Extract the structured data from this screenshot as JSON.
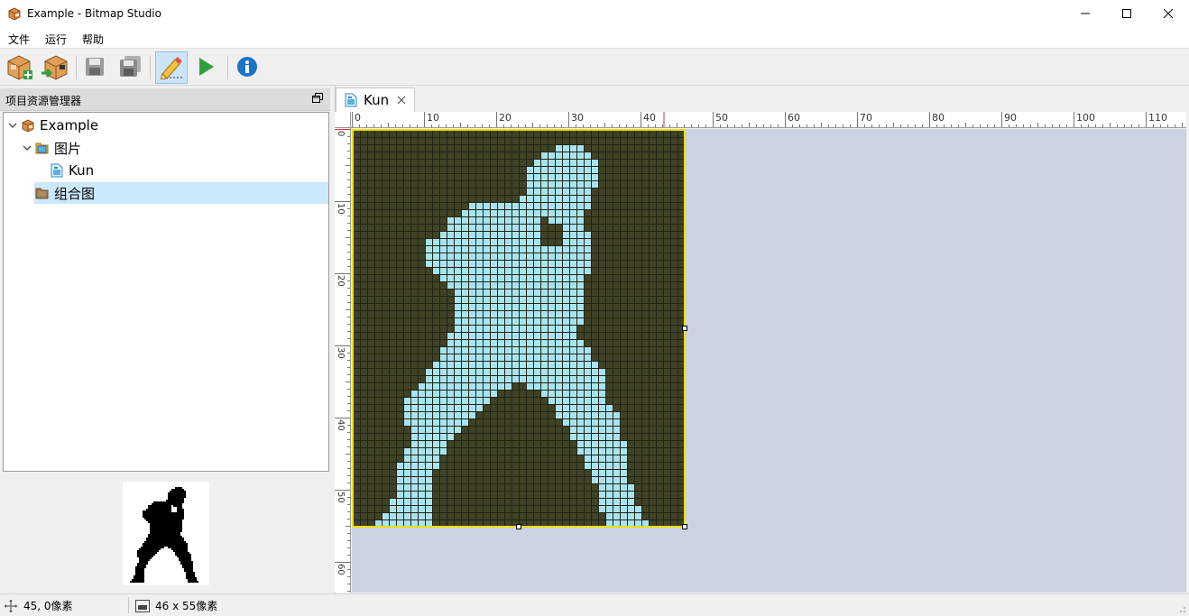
{
  "window": {
    "title": "Example - Bitmap Studio",
    "app_icon": "package-icon"
  },
  "menu": {
    "items": [
      "文件",
      "运行",
      "帮助"
    ]
  },
  "toolbar": {
    "buttons": [
      {
        "name": "new-project-button",
        "icon": "package-add-icon"
      },
      {
        "name": "open-project-button",
        "icon": "package-open-icon"
      },
      {
        "name": "save-button",
        "icon": "floppy-disk-icon"
      },
      {
        "name": "save-all-button",
        "icon": "floppy-disks-icon"
      },
      {
        "name": "edit-mode-button",
        "icon": "pencil-icon",
        "active": true
      },
      {
        "name": "run-button",
        "icon": "play-icon"
      },
      {
        "name": "about-button",
        "icon": "info-icon"
      }
    ]
  },
  "explorer": {
    "title": "项目资源管理器",
    "tree": [
      {
        "label": "Example",
        "icon": "package-icon",
        "expanded": true,
        "level": 0
      },
      {
        "label": "图片",
        "icon": "folder-icon",
        "expanded": true,
        "level": 1
      },
      {
        "label": "Kun",
        "icon": "bitmap-file-icon",
        "level": 2
      },
      {
        "label": "组合图",
        "icon": "folder-closed-icon",
        "level": 1,
        "selected": true
      }
    ]
  },
  "document": {
    "tab_label": "Kun",
    "ruler_h_labels": [
      "0",
      "10",
      "20",
      "30",
      "40",
      "50",
      "60",
      "70",
      "80",
      "90",
      "100",
      "110"
    ],
    "ruler_v_labels": [
      "0",
      "10",
      "20",
      "30",
      "40",
      "50",
      "60"
    ],
    "bitmap": {
      "width": 46,
      "height": 55,
      "background_color": "#3f4225",
      "pixel_color": "#a8e4f0",
      "grid_color": "#222414",
      "border_color": "#f0e000",
      "ruler_marker_color": "#e03030"
    }
  },
  "status": {
    "cursor": "45, 0像素",
    "size": "46 x 55像素"
  }
}
